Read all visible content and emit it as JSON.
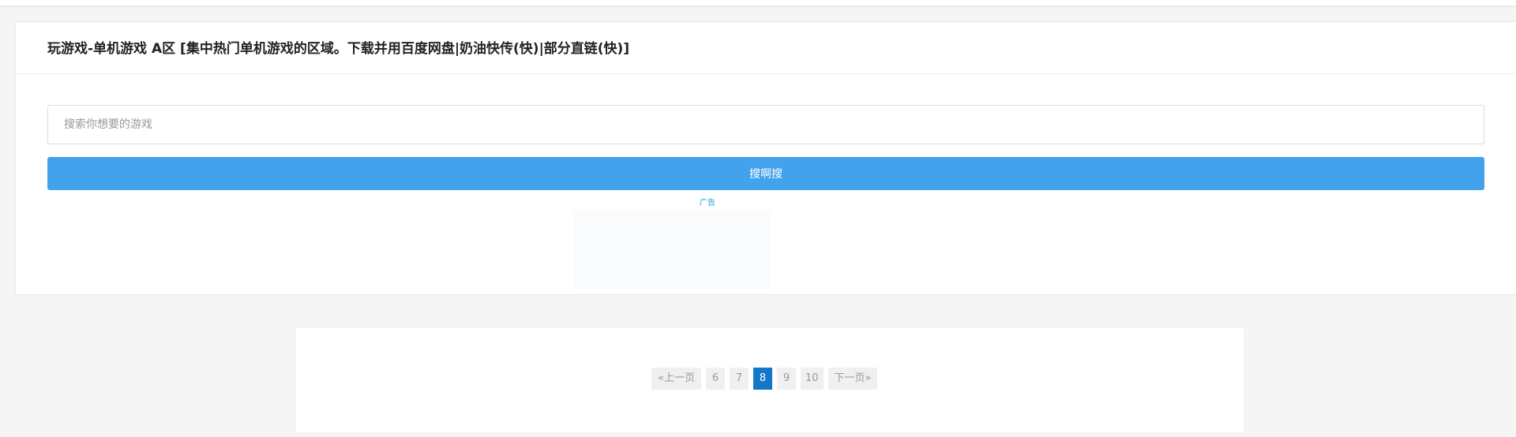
{
  "header": {
    "title": "玩游戏-单机游戏 A区 [集中热门单机游戏的区域。下载并用百度网盘|奶油快传(快)|部分直链(快)]"
  },
  "search": {
    "placeholder": "搜索你想要的游戏",
    "value": "",
    "button_label": "搜啊搜"
  },
  "ad": {
    "label": "广告"
  },
  "pagination": {
    "prev_label": "«上一页",
    "pages": [
      "6",
      "7",
      "8",
      "9",
      "10"
    ],
    "current_page": "8",
    "next_label": "下一页»"
  },
  "colors": {
    "accent": "#42a3ec",
    "active_page": "#1476c9",
    "ad_link": "#1e9be0"
  }
}
